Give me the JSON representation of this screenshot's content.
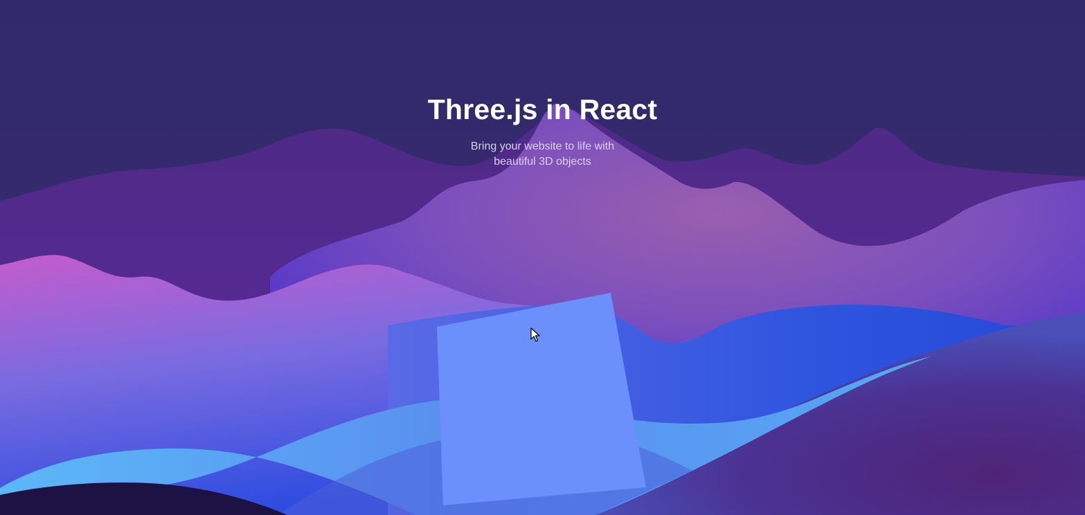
{
  "hero": {
    "title": "Three.js in React",
    "subtitle_line1": "Bring your website to life with",
    "subtitle_line2": "beautiful 3D objects"
  },
  "colors": {
    "sky": "#312a6b",
    "far_mountain": "#4e2a80",
    "mid_mountain": "#8b5bb8",
    "pink_hill": "#b35fd0",
    "blue_wave": "#2f5be0",
    "light_wave": "#56aef5",
    "right_hill": "#4a2a80",
    "dark_foreground": "#1c1244",
    "cube": "#6b8ffb",
    "title_text": "#ffffff",
    "subtitle_text": "#d9d2ef"
  },
  "icons": {
    "cursor": "arrow-cursor-icon",
    "cube": "3d-cube"
  }
}
